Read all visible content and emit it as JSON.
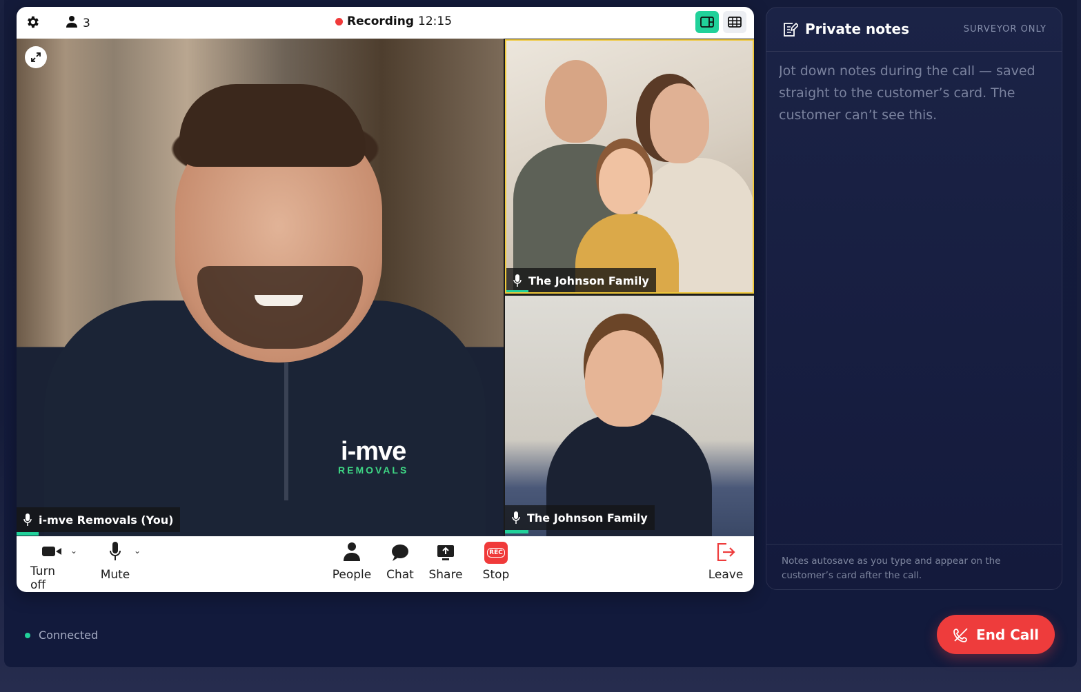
{
  "call": {
    "participant_count": "3",
    "recording_label": "Recording",
    "recording_time": "12:15"
  },
  "tiles": {
    "main": {
      "name": "i-mve Removals (You)",
      "logo_line1": "i-mve",
      "logo_line2": "REMOVALS"
    },
    "top_right": {
      "name": "The Johnson Family"
    },
    "bottom_right": {
      "name": "The Johnson Family"
    }
  },
  "controls": {
    "camera": "Turn off",
    "mic": "Mute",
    "people": "People",
    "chat": "Chat",
    "share": "Share",
    "stop": "Stop",
    "rec_badge": "REC",
    "leave": "Leave"
  },
  "notes": {
    "title": "Private notes",
    "badge": "SURVEYOR ONLY",
    "placeholder": "Jot down notes during the call — saved straight to the customer’s card. The customer can’t see this.",
    "footer": "Notes autosave as you type and appear on the customer’s card after the call."
  },
  "status": {
    "label": "Connected"
  },
  "end_call": {
    "label": "End Call"
  },
  "colors": {
    "accent": "#21d19a",
    "danger": "#ee3c3c",
    "highlight": "#f0c93b"
  }
}
